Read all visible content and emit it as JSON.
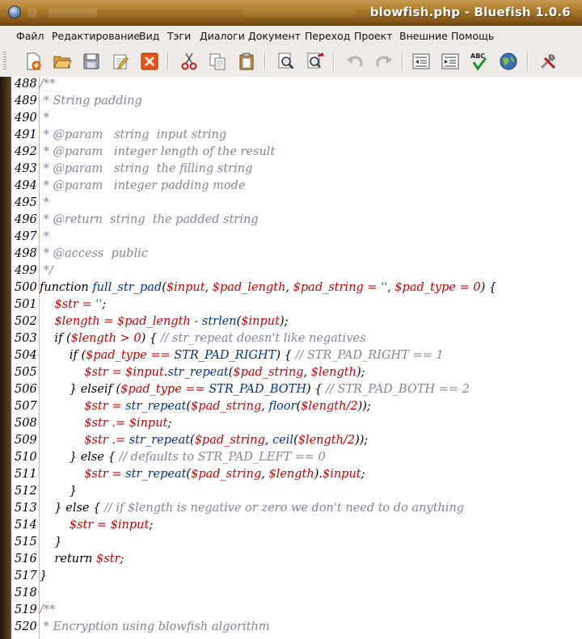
{
  "window": {
    "title": "blowfish.php - Bluefish 1.0.6"
  },
  "menu": [
    "Файл",
    "Редактирование",
    "Вид",
    "Тэги",
    "Диалоги",
    "Документ",
    "Переход",
    "Проект",
    "Внешние",
    "Помощь"
  ],
  "toolbar": {
    "buttons": [
      "new-file-icon",
      "open-file-icon",
      "save-icon",
      "edit-preferences-icon",
      "close-document-icon",
      "cut-icon",
      "copy-icon",
      "paste-icon",
      "find-icon",
      "replace-icon",
      "undo-icon",
      "redo-icon",
      "unindent-icon",
      "indent-icon",
      "spellcheck-icon",
      "preview-browser-icon",
      "tools-icon"
    ],
    "spellcheck_text": "ABC"
  },
  "editor": {
    "lines": [
      {
        "n": "488",
        "parts": [
          [
            "c",
            "/**"
          ]
        ]
      },
      {
        "n": "489",
        "parts": [
          [
            "c",
            " * String padding"
          ]
        ]
      },
      {
        "n": "490",
        "parts": [
          [
            "c",
            " *"
          ]
        ]
      },
      {
        "n": "491",
        "parts": [
          [
            "c",
            " * @param   string  input string"
          ]
        ]
      },
      {
        "n": "492",
        "parts": [
          [
            "c",
            " * @param   integer length of the result"
          ]
        ]
      },
      {
        "n": "493",
        "parts": [
          [
            "c",
            " * @param   string  the filling string"
          ]
        ]
      },
      {
        "n": "494",
        "parts": [
          [
            "c",
            " * @param   integer padding mode"
          ]
        ]
      },
      {
        "n": "495",
        "parts": [
          [
            "c",
            " *"
          ]
        ]
      },
      {
        "n": "496",
        "parts": [
          [
            "c",
            " * @return  string  the padded string"
          ]
        ]
      },
      {
        "n": "497",
        "parts": [
          [
            "c",
            " *"
          ]
        ]
      },
      {
        "n": "498",
        "parts": [
          [
            "c",
            " * @access  public"
          ]
        ]
      },
      {
        "n": "499",
        "parts": [
          [
            "c",
            " */"
          ]
        ]
      },
      {
        "n": "500",
        "parts": [
          [
            "k",
            "function "
          ],
          [
            "f",
            "full_str_pad"
          ],
          [
            "k",
            "("
          ],
          [
            "v",
            "$input"
          ],
          [
            "k",
            ", "
          ],
          [
            "v",
            "$pad_length"
          ],
          [
            "k",
            ", "
          ],
          [
            "v",
            "$pad_string"
          ],
          [
            "v",
            " = "
          ],
          [
            "s",
            "''"
          ],
          [
            "k",
            ", "
          ],
          [
            "v",
            "$pad_type"
          ],
          [
            "v",
            " = "
          ],
          [
            "n",
            "0"
          ],
          [
            "k",
            ") {"
          ]
        ]
      },
      {
        "n": "501",
        "parts": [
          [
            "k",
            "    "
          ],
          [
            "v",
            "$str"
          ],
          [
            "v",
            " = "
          ],
          [
            "s",
            "''"
          ],
          [
            "k",
            ";"
          ]
        ]
      },
      {
        "n": "502",
        "parts": [
          [
            "k",
            "    "
          ],
          [
            "v",
            "$length"
          ],
          [
            "v",
            " = "
          ],
          [
            "v",
            "$pad_length"
          ],
          [
            "v",
            " - "
          ],
          [
            "f",
            "strlen"
          ],
          [
            "k",
            "("
          ],
          [
            "v",
            "$input"
          ],
          [
            "k",
            ");"
          ]
        ]
      },
      {
        "n": "503",
        "parts": [
          [
            "k",
            "    if ("
          ],
          [
            "v",
            "$length"
          ],
          [
            "v",
            " > "
          ],
          [
            "n",
            "0"
          ],
          [
            "k",
            ") { "
          ],
          [
            "c",
            "// str_repeat doesn't like negatives"
          ]
        ]
      },
      {
        "n": "504",
        "parts": [
          [
            "k",
            "        if ("
          ],
          [
            "v",
            "$pad_type"
          ],
          [
            "v",
            " == "
          ],
          [
            "f",
            "STR_PAD_RIGHT"
          ],
          [
            "k",
            ") { "
          ],
          [
            "c",
            "// STR_PAD_RIGHT == 1"
          ]
        ]
      },
      {
        "n": "505",
        "parts": [
          [
            "k",
            "            "
          ],
          [
            "v",
            "$str"
          ],
          [
            "v",
            " = "
          ],
          [
            "v",
            "$input"
          ],
          [
            "k",
            "."
          ],
          [
            "f",
            "str_repeat"
          ],
          [
            "k",
            "("
          ],
          [
            "v",
            "$pad_string"
          ],
          [
            "k",
            ", "
          ],
          [
            "v",
            "$length"
          ],
          [
            "k",
            ");"
          ]
        ]
      },
      {
        "n": "506",
        "parts": [
          [
            "k",
            "        } elseif ("
          ],
          [
            "v",
            "$pad_type"
          ],
          [
            "v",
            " == "
          ],
          [
            "f",
            "STR_PAD_BOTH"
          ],
          [
            "k",
            ") { "
          ],
          [
            "c",
            "// STR_PAD_BOTH == 2"
          ]
        ]
      },
      {
        "n": "507",
        "parts": [
          [
            "k",
            "            "
          ],
          [
            "v",
            "$str"
          ],
          [
            "v",
            " = "
          ],
          [
            "f",
            "str_repeat"
          ],
          [
            "k",
            "("
          ],
          [
            "v",
            "$pad_string"
          ],
          [
            "k",
            ", "
          ],
          [
            "f",
            "floor"
          ],
          [
            "k",
            "("
          ],
          [
            "v",
            "$length"
          ],
          [
            "v",
            "/"
          ],
          [
            "n",
            "2"
          ],
          [
            "k",
            "));"
          ]
        ]
      },
      {
        "n": "508",
        "parts": [
          [
            "k",
            "            "
          ],
          [
            "v",
            "$str"
          ],
          [
            "v",
            " .= "
          ],
          [
            "v",
            "$input"
          ],
          [
            "k",
            ";"
          ]
        ]
      },
      {
        "n": "509",
        "parts": [
          [
            "k",
            "            "
          ],
          [
            "v",
            "$str"
          ],
          [
            "v",
            " .= "
          ],
          [
            "f",
            "str_repeat"
          ],
          [
            "k",
            "("
          ],
          [
            "v",
            "$pad_string"
          ],
          [
            "k",
            ", "
          ],
          [
            "f",
            "ceil"
          ],
          [
            "k",
            "("
          ],
          [
            "v",
            "$length"
          ],
          [
            "v",
            "/"
          ],
          [
            "n",
            "2"
          ],
          [
            "k",
            "));"
          ]
        ]
      },
      {
        "n": "510",
        "parts": [
          [
            "k",
            "        } else { "
          ],
          [
            "c",
            "// defaults to STR_PAD_LEFT == 0"
          ]
        ]
      },
      {
        "n": "511",
        "parts": [
          [
            "k",
            "            "
          ],
          [
            "v",
            "$str"
          ],
          [
            "v",
            " = "
          ],
          [
            "f",
            "str_repeat"
          ],
          [
            "k",
            "("
          ],
          [
            "v",
            "$pad_string"
          ],
          [
            "k",
            ", "
          ],
          [
            "v",
            "$length"
          ],
          [
            "k",
            ")."
          ],
          [
            "v",
            "$input"
          ],
          [
            "k",
            ";"
          ]
        ]
      },
      {
        "n": "512",
        "parts": [
          [
            "k",
            "        }"
          ]
        ]
      },
      {
        "n": "513",
        "parts": [
          [
            "k",
            "    } else { "
          ],
          [
            "c",
            "// if $length is negative or zero we don't need to do anything"
          ]
        ]
      },
      {
        "n": "514",
        "parts": [
          [
            "k",
            "        "
          ],
          [
            "v",
            "$str"
          ],
          [
            "v",
            " = "
          ],
          [
            "v",
            "$input"
          ],
          [
            "k",
            ";"
          ]
        ]
      },
      {
        "n": "515",
        "parts": [
          [
            "k",
            "    }"
          ]
        ]
      },
      {
        "n": "516",
        "parts": [
          [
            "k",
            "    return "
          ],
          [
            "v",
            "$str"
          ],
          [
            "k",
            ";"
          ]
        ]
      },
      {
        "n": "517",
        "parts": [
          [
            "k",
            "}"
          ]
        ]
      },
      {
        "n": "518",
        "parts": []
      },
      {
        "n": "519",
        "parts": [
          [
            "c",
            "/**"
          ]
        ]
      },
      {
        "n": "520",
        "parts": [
          [
            "c",
            " * Encryption using blowfish algorithm"
          ]
        ]
      }
    ]
  }
}
